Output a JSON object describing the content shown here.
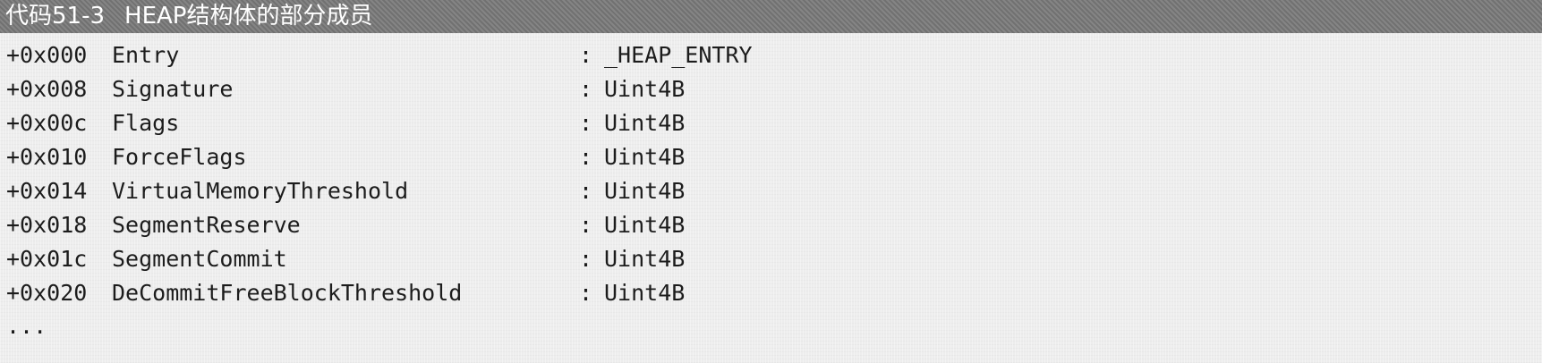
{
  "caption": {
    "number": "代码51-3",
    "title": "HEAP结构体的部分成员"
  },
  "fields": [
    {
      "offset": "+0x000",
      "name": "Entry",
      "sep": ":",
      "type": "_HEAP_ENTRY"
    },
    {
      "offset": "+0x008",
      "name": "Signature",
      "sep": ":",
      "type": "Uint4B"
    },
    {
      "offset": "+0x00c",
      "name": "Flags",
      "sep": ":",
      "type": "Uint4B"
    },
    {
      "offset": "+0x010",
      "name": "ForceFlags",
      "sep": ":",
      "type": "Uint4B"
    },
    {
      "offset": "+0x014",
      "name": "VirtualMemoryThreshold",
      "sep": ":",
      "type": "Uint4B"
    },
    {
      "offset": "+0x018",
      "name": "SegmentReserve",
      "sep": ":",
      "type": "Uint4B"
    },
    {
      "offset": "+0x01c",
      "name": "SegmentCommit",
      "sep": ":",
      "type": "Uint4B"
    },
    {
      "offset": "+0x020",
      "name": "DeCommitFreeBlockThreshold",
      "sep": ":",
      "type": "Uint4B"
    }
  ],
  "ellipsis": "..."
}
